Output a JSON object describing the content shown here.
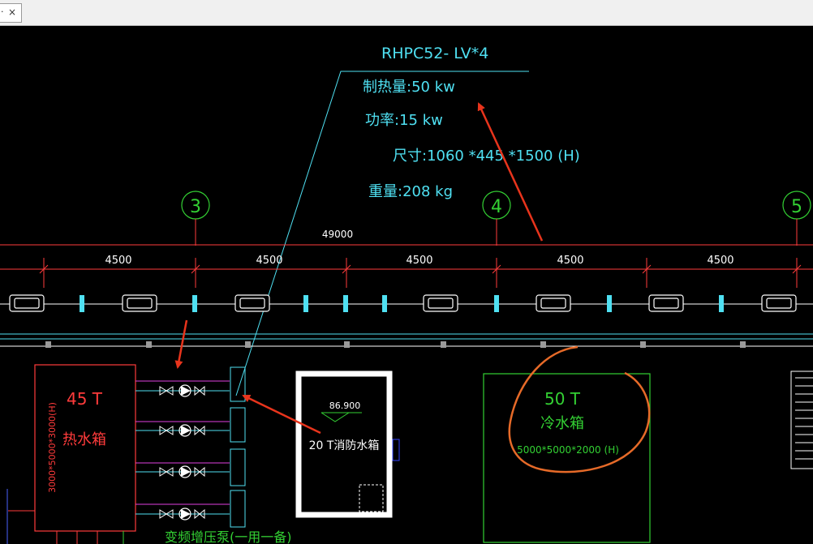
{
  "tab": {
    "label": "·",
    "close_glyph": "×"
  },
  "drawing": {
    "equipment_label": {
      "model": "RHPC52- LV*4",
      "heating": "制热量:50 kw",
      "power": "功率:15 kw",
      "size": "尺寸:1060 *445 *1500 (H)",
      "weight": "重量:208 kg"
    },
    "grid_axes": [
      "3",
      "4",
      "5"
    ],
    "overall_dim": "49000",
    "bay_dims": [
      "4500",
      "4500",
      "4500",
      "4500",
      "4500"
    ],
    "hot_tank": {
      "capacity": "45 T",
      "name": "热水箱",
      "size": "3000*5000*3000(H)"
    },
    "fire_tank": {
      "elevation": "86.900",
      "name": "20 T消防水箱"
    },
    "cold_tank": {
      "capacity": "50 T",
      "name": "冷水箱",
      "size": "5000*5000*2000 (H)"
    },
    "pump_note": "变频增压泵(一用一备)"
  },
  "colors": {
    "red": "#ff3b3b",
    "cyan": "#4fe0f2",
    "green": "#33d033",
    "magenta": "#e040e0",
    "white": "#ffffff",
    "annotation_red": "#e8341c",
    "annotation_orange": "#e66a28"
  }
}
